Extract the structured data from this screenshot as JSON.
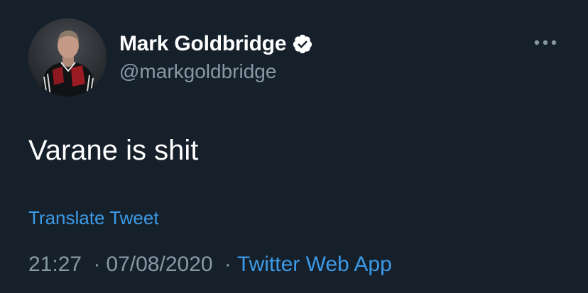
{
  "tweet": {
    "display_name": "Mark Goldbridge",
    "handle": "@markgoldbridge",
    "verified": true,
    "text": "Varane is shit",
    "translate_label": "Translate Tweet",
    "time": "21:27",
    "date": "07/08/2020",
    "separator": "·",
    "source": "Twitter Web App"
  },
  "icons": {
    "verified": "verified-badge-icon",
    "more": "more-options-icon"
  },
  "colors": {
    "background": "#15202b",
    "primary_text": "#ffffff",
    "secondary_text": "#8899a6",
    "link": "#3c9ae6"
  }
}
